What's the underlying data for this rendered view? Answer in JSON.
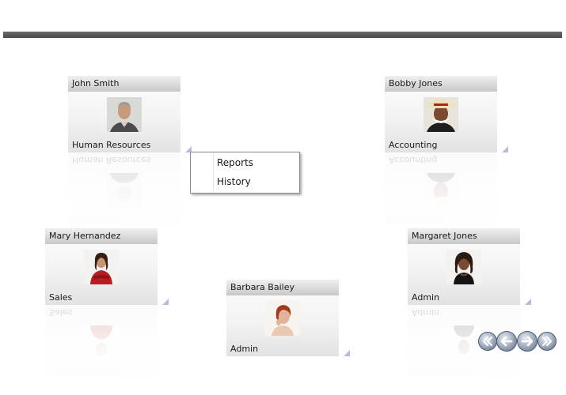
{
  "cards": [
    {
      "id": "john-smith",
      "name": "John Smith",
      "department": "Human Resources",
      "photo": "man-grey-hair-portrait"
    },
    {
      "id": "bobby-jones",
      "name": "Bobby Jones",
      "department": "Accounting",
      "photo": "man-straw-hat-portrait"
    },
    {
      "id": "mary-hernandez",
      "name": "Mary Hernandez",
      "department": "Sales",
      "photo": "woman-red-sweater-portrait"
    },
    {
      "id": "barbara-bailey",
      "name": "Barbara Bailey",
      "department": "Admin",
      "photo": "woman-red-hair-portrait"
    },
    {
      "id": "margaret-jones",
      "name": "Margaret Jones",
      "department": "Admin",
      "photo": "woman-black-top-portrait"
    }
  ],
  "context_menu": {
    "items": [
      "Reports",
      "History"
    ]
  },
  "navigation": {
    "buttons": [
      "first-icon",
      "previous-icon",
      "next-icon",
      "last-icon"
    ]
  },
  "colors": {
    "header_bar": "#555555",
    "card_header": "#c8c8c8",
    "corner_indicator": "#b7bcd8",
    "nav_button": "#9aa6b8"
  }
}
